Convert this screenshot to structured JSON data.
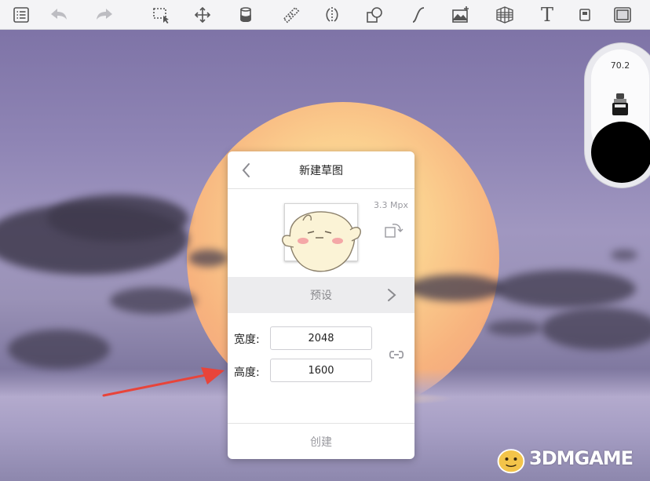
{
  "brush_panel": {
    "size_value": "70.2",
    "color": "#000000"
  },
  "dialog": {
    "title": "新建草图",
    "megapixels": "3.3 Mpx",
    "preset_label": "预设",
    "width_label": "宽度:",
    "width_value": "2048",
    "height_label": "高度:",
    "height_value": "1600",
    "create_label": "创建"
  },
  "watermark": {
    "text": "3DMGAME"
  },
  "colors": {
    "annotation_arrow": "#e8443a",
    "toolbar_bg": "#f4f4f6"
  }
}
